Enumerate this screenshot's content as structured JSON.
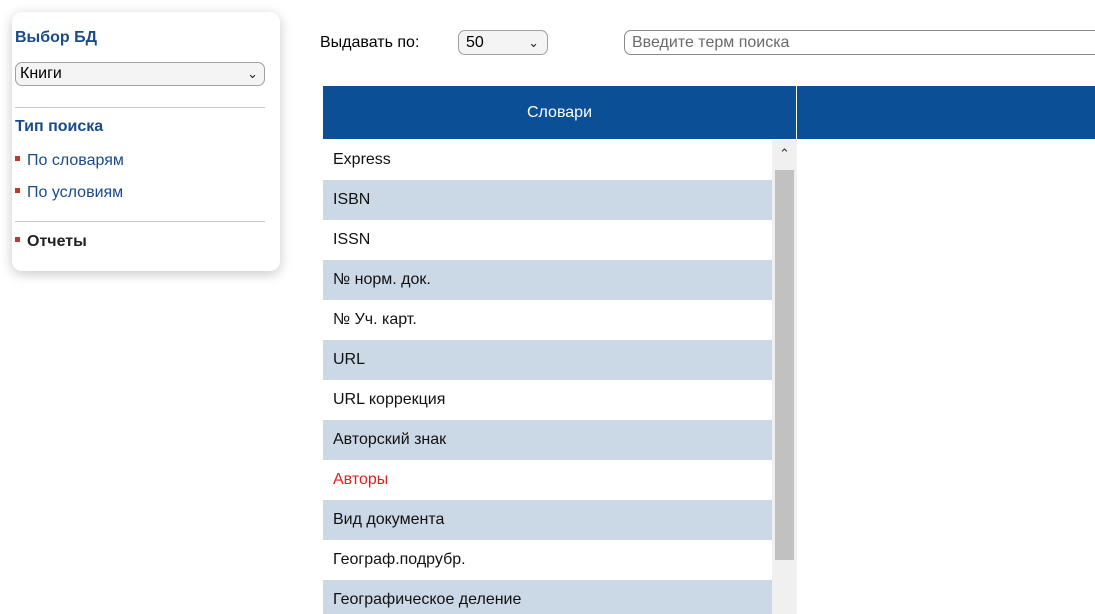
{
  "sidebar": {
    "db_title": "Выбор БД",
    "db_selected": "Книги",
    "search_type_title": "Тип поиска",
    "links": [
      {
        "label": "По словарям"
      },
      {
        "label": "По условиям"
      }
    ],
    "reports_label": "Отчеты"
  },
  "toolbar": {
    "per_page_label": "Выдавать по:",
    "per_page_value": "50",
    "search_placeholder": "Введите терм поиска",
    "search_value": ""
  },
  "table": {
    "header": "Словари",
    "rows": [
      "Express",
      "ISBN",
      "ISSN",
      "№ норм. док.",
      "№ Уч. карт.",
      "URL",
      "URL коррекция",
      "Авторский знак",
      "Авторы",
      "Вид документа",
      "Географ.подрубр.",
      "Географическое деление"
    ],
    "active_row": "Авторы"
  },
  "icons": {
    "select_chevron": "chevron-down-icon",
    "scroll_up": "chevron-up-icon",
    "bullet": "square-bullet-icon"
  },
  "colors": {
    "brand_blue": "#0b4f96",
    "link_blue": "#1a4a8b",
    "row_alt": "#cbd8e6",
    "active_red": "#e02020",
    "bullet_red": "#c0392b"
  }
}
